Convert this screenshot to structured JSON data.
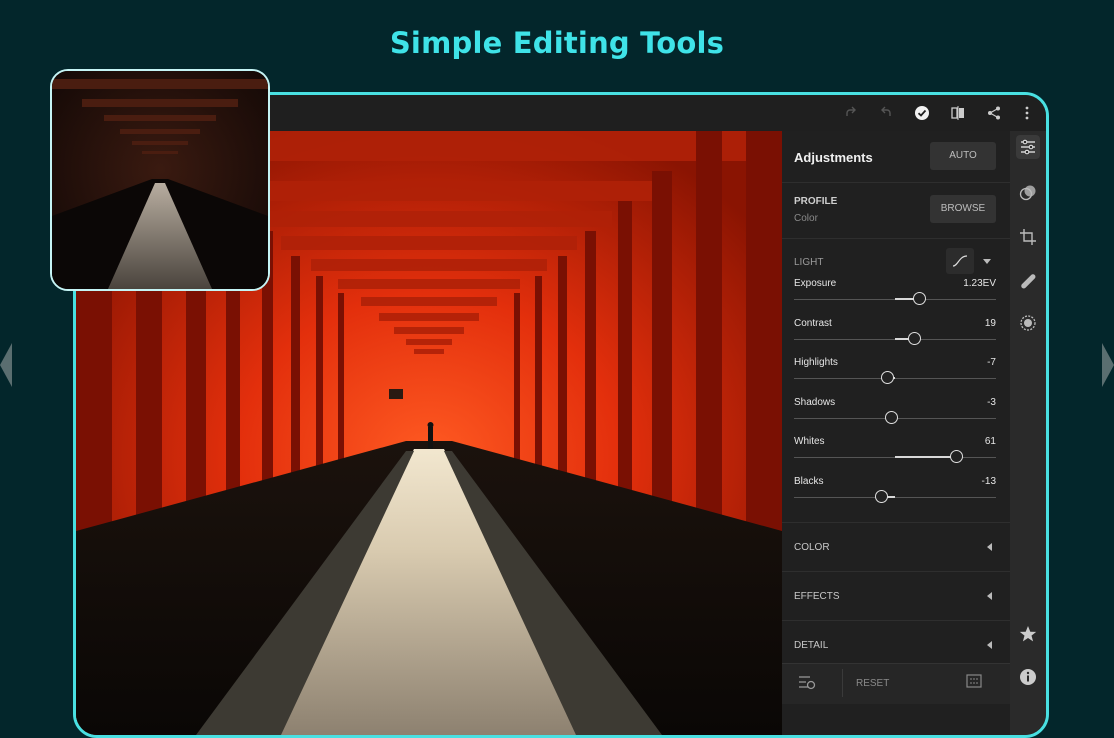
{
  "headline": "Simple Editing Tools",
  "panel": {
    "title": "Adjustments",
    "auto_label": "AUTO",
    "profile_label": "PROFILE",
    "profile_value": "Color",
    "browse_label": "BROWSE",
    "light_label": "LIGHT",
    "sliders": [
      {
        "name": "Exposure",
        "value": "1.23EV",
        "level": 0.62
      },
      {
        "name": "Contrast",
        "value": "19",
        "level": 0.595
      },
      {
        "name": "Highlights",
        "value": "-7",
        "level": 0.465
      },
      {
        "name": "Shadows",
        "value": "-3",
        "level": 0.485
      },
      {
        "name": "Whites",
        "value": "61",
        "level": 0.805
      },
      {
        "name": "Blacks",
        "value": "-13",
        "level": 0.435
      }
    ],
    "collapsed_sections": [
      "COLOR",
      "EFFECTS",
      "DETAIL"
    ],
    "reset_label": "RESET"
  },
  "topbar_icons": [
    "redo-icon",
    "undo-icon",
    "confirm-check-icon",
    "compare-icon",
    "share-icon",
    "more-icon"
  ],
  "rail_icons": [
    "adjustments-sliders-icon",
    "selective-edit-icon",
    "crop-icon",
    "healing-brush-icon",
    "presets-icon",
    "star-rating-icon",
    "info-icon"
  ],
  "colors": {
    "accent": "#3fe3e8",
    "background": "#03262b",
    "frame": "#49e0e2"
  }
}
